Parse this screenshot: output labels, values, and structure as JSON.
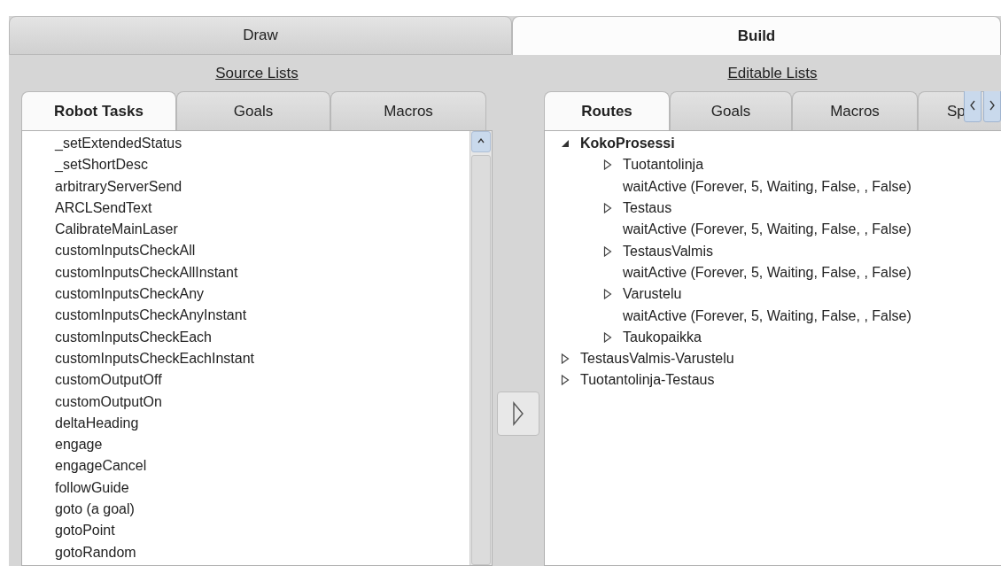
{
  "main_tabs": [
    {
      "label": "Draw",
      "selected": false
    },
    {
      "label": "Build",
      "selected": true
    }
  ],
  "source": {
    "heading": "Source Lists",
    "tabs": [
      {
        "label": "Robot Tasks",
        "selected": true
      },
      {
        "label": "Goals",
        "selected": false
      },
      {
        "label": "Macros",
        "selected": false
      }
    ],
    "items": [
      "_setExtendedStatus",
      "_setShortDesc",
      "arbitraryServerSend",
      "ARCLSendText",
      "CalibrateMainLaser",
      "customInputsCheckAll",
      "customInputsCheckAllInstant",
      "customInputsCheckAny",
      "customInputsCheckAnyInstant",
      "customInputsCheckEach",
      "customInputsCheckEachInstant",
      "customOutputOff",
      "customOutputOn",
      "deltaHeading",
      "engage",
      "engageCancel",
      "followGuide",
      "goto (a goal)",
      "gotoPoint",
      "gotoRandom"
    ]
  },
  "editable": {
    "heading": "Editable Lists",
    "tabs": [
      {
        "label": "Routes",
        "selected": true
      },
      {
        "label": "Goals",
        "selected": false
      },
      {
        "label": "Macros",
        "selected": false
      },
      {
        "label": "Sp",
        "selected": false
      }
    ],
    "tree": [
      {
        "kind": "node",
        "label": "KokoProsessi",
        "expanded": true,
        "children": [
          {
            "kind": "node",
            "label": "Tuotantolinja",
            "expanded": false
          },
          {
            "kind": "step",
            "label": "waitActive (Forever, 5, Waiting, False, , False)"
          },
          {
            "kind": "node",
            "label": "Testaus",
            "expanded": false
          },
          {
            "kind": "step",
            "label": "waitActive (Forever, 5, Waiting, False, , False)"
          },
          {
            "kind": "node",
            "label": "TestausValmis",
            "expanded": false
          },
          {
            "kind": "step",
            "label": "waitActive (Forever, 5, Waiting, False, , False)"
          },
          {
            "kind": "node",
            "label": "Varustelu",
            "expanded": false
          },
          {
            "kind": "step",
            "label": "waitActive (Forever, 5, Waiting, False, , False)"
          },
          {
            "kind": "node",
            "label": "Taukopaikka",
            "expanded": false
          }
        ]
      },
      {
        "kind": "node",
        "label": "TestausValmis-Varustelu",
        "expanded": false
      },
      {
        "kind": "node",
        "label": "Tuotantolinja-Testaus",
        "expanded": false
      }
    ]
  }
}
